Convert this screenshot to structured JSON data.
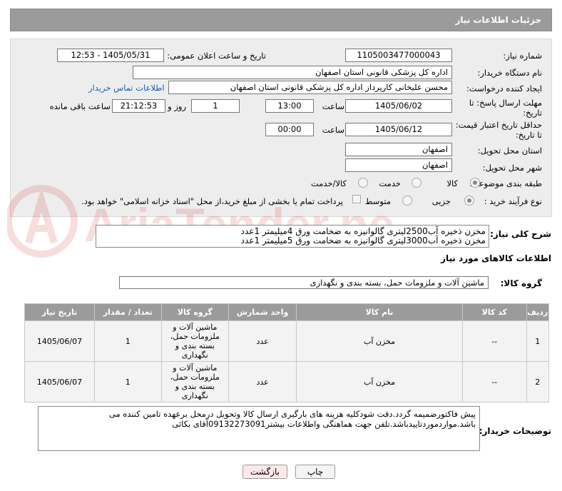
{
  "header": {
    "title": "جزئیات اطلاعات نیاز"
  },
  "form": {
    "need_number_label": "شماره نیاز:",
    "need_number": "1105003477000043",
    "announce_label": "تاریخ و ساعت اعلان عمومی:",
    "announce_value": "1405/05/31 - 12:53",
    "buyer_org_label": "نام دستگاه خریدار:",
    "buyer_org": "اداره کل پزشکی قانونی استان اصفهان",
    "creator_label": "ایجاد کننده درخواست:",
    "creator": "محسن علیخانی کارپرداز اداره کل پزشکی قانونی استان اصفهان",
    "contact_link": "اطلاعات تماس خریدار",
    "reply_deadline_label_1": "مهلت ارسال پاسخ: تا",
    "reply_deadline_label_2": "تاریخ:",
    "reply_date": "1405/06/02",
    "time_label": "ساعت",
    "reply_time": "13:00",
    "days_count": "1",
    "days_label": "روز و",
    "remaining_time": "21:12:53",
    "remaining_label": "ساعت باقی مانده",
    "price_validity_label_1": "حداقل تاریخ اعتبار قیمت:",
    "price_validity_label_2": "تا تاریخ:",
    "price_date": "1405/06/12",
    "price_time": "00:00",
    "province_label": "استان محل تحویل:",
    "province": "اصفهان",
    "city_label": "شهر محل تحویل:",
    "city": "اصفهان",
    "category_label": "طبقه بندی موضوعی:",
    "category_options": [
      "کالا",
      "خدمت",
      "کالا/خدمت"
    ],
    "process_label": "نوع فرآیند خرید :",
    "process_options": [
      "جزیی",
      "متوسط"
    ],
    "payment_note": "پرداخت تمام یا بخشی از مبلغ خرید،از محل \"اسناد خزانه اسلامی\" خواهد بود."
  },
  "general_desc": {
    "label": "شرح کلی نیاز:",
    "line1": "مخزن ذخیره آب2500لیتری گالوانیزه به ضخامت ورق 4میلیمتر 1عدد",
    "line2": "مخزن ذخیره آب3000لیتری گالوانیزه به ضخامت ورق 5میلیمتر 1عدد"
  },
  "items_section": {
    "title": "اطلاعات کالاهای مورد نیاز",
    "group_label": "گروه کالا:",
    "group_value": "ماشین آلات و ملزومات حمل، بسته بندی و نگهداری",
    "columns": [
      "ردیف",
      "کد کالا",
      "نام کالا",
      "واحد شمارش",
      "گروه کالا",
      "تعداد / مقدار",
      "تاریخ نیاز"
    ],
    "rows": [
      {
        "idx": "1",
        "code": "--",
        "name": "مخزن آب",
        "unit": "عدد",
        "group": "ماشین آلات و ملزومات حمل، بسته بندی و نگهداری",
        "qty": "1",
        "date": "1405/06/07"
      },
      {
        "idx": "2",
        "code": "--",
        "name": "مخزن آب",
        "unit": "عدد",
        "group": "ماشین آلات و ملزومات حمل، بسته بندی و نگهداری",
        "qty": "1",
        "date": "1405/06/07"
      }
    ]
  },
  "buyer_notes": {
    "label": "توضیحات خریدار:",
    "text": "پیش فاکتورضمیمه گردد.دقت شودکلیه هزینه های بارگیری ارسال کالا وتحویل درمحل برعهده تامین کننده می باشد.مواردموردتاییدباشد.تلفن جهت هماهنگی واطلاعات بیشتر09132273091آقای بکائی"
  },
  "buttons": {
    "print": "چاپ",
    "back": "بازگشت"
  },
  "watermark": "AriaTender.neT",
  "colors": {
    "header": "#9b9b9b",
    "panel": "#ededed",
    "link": "#1a5fb4",
    "back_button": "#fde8e8"
  }
}
